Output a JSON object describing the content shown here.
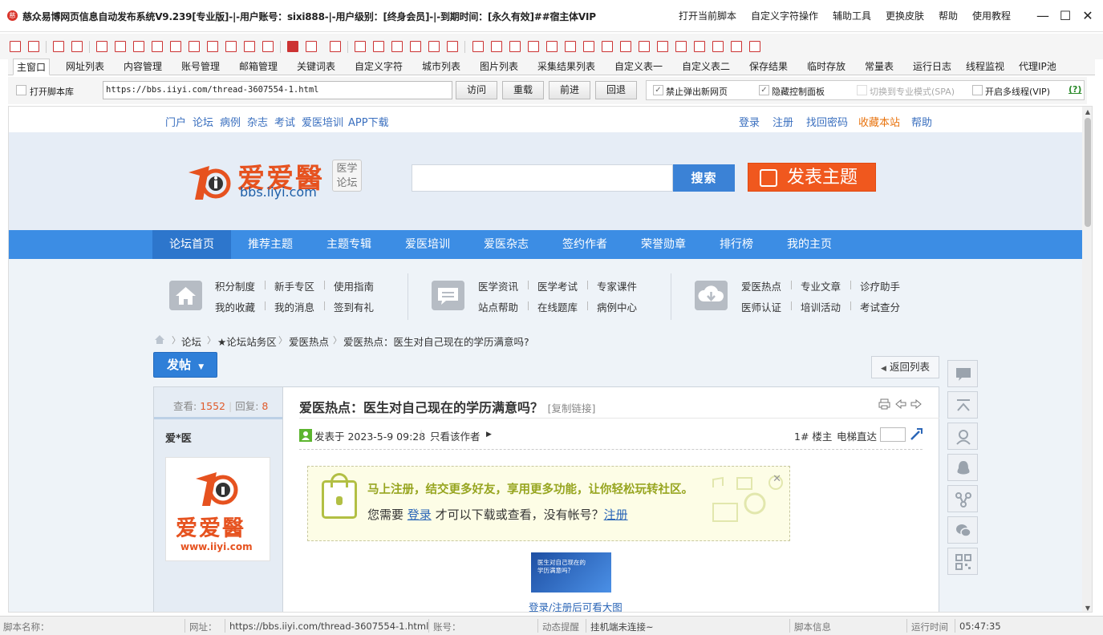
{
  "window": {
    "title": "慈众易博网页信息自动发布系统V9.239[专业版]-|-用户账号：sixi888-|-用户级别：[终身会员]-|-到期时间：[永久有效]##宿主体VIP",
    "menu": [
      "打开当前脚本",
      "自定义字符操作",
      "辅助工具",
      "更换皮肤",
      "帮助",
      "使用教程"
    ],
    "controls": {
      "minimize": "—",
      "maximize": "☐",
      "close": "✕"
    }
  },
  "tabs": [
    "主窗口",
    "网址列表",
    "内容管理",
    "账号管理",
    "邮箱管理",
    "关键词表",
    "自定义字符",
    "城市列表",
    "图片列表",
    "采集结果列表",
    "自定义表一",
    "自定义表二",
    "保存结果",
    "临时存放",
    "常量表",
    "运行日志",
    "线程监视",
    "代理IP池"
  ],
  "addressbar": {
    "open_script_lib": "打开脚本库",
    "url": "https://bbs.iiyi.com/thread-3607554-1.html",
    "buttons": [
      "访问",
      "重载",
      "前进",
      "回退"
    ],
    "options": [
      {
        "label": "禁止弹出新网页",
        "checked": true,
        "disabled": false
      },
      {
        "label": "隐藏控制面板",
        "checked": true,
        "disabled": false
      },
      {
        "label": "切换到专业模式(SPA)",
        "checked": false,
        "disabled": true
      },
      {
        "label": "开启多线程(VIP)",
        "checked": false,
        "disabled": false
      }
    ],
    "help": "(?)"
  },
  "site": {
    "toplinks_left": [
      "门户",
      "论坛",
      "病例",
      "杂志",
      "考试",
      "爱医培训",
      "APP下载"
    ],
    "toplinks_right": [
      "登录",
      "注册",
      "找回密码",
      "收藏本站",
      "帮助"
    ],
    "logo_text": "爱爱醫",
    "logo_domain": "bbs.iiyi.com",
    "logo_badge_1": "医学",
    "logo_badge_2": "论坛",
    "search_button": "搜索",
    "post_button": "发表主题",
    "nav": [
      "论坛首页",
      "推荐主题",
      "主题专辑",
      "爱医培训",
      "爱医杂志",
      "签约作者",
      "荣誉勋章",
      "排行榜",
      "我的主页"
    ],
    "quick_groups": [
      {
        "icon": "home-icon",
        "row1": [
          "积分制度",
          "新手专区",
          "使用指南"
        ],
        "row2": [
          "我的收藏",
          "我的消息",
          "签到有礼"
        ]
      },
      {
        "icon": "message-icon",
        "row1": [
          "医学资讯",
          "医学考试",
          "专家课件"
        ],
        "row2": [
          "站点帮助",
          "在线题库",
          "病例中心"
        ]
      },
      {
        "icon": "download-cloud-icon",
        "row1": [
          "爱医热点",
          "专业文章",
          "诊疗助手"
        ],
        "row2": [
          "医师认证",
          "培训活动",
          "考试查分"
        ]
      }
    ],
    "breadcrumb": [
      "论坛",
      "★论坛站务区",
      "爱医热点",
      "爱医热点：医生对自己现在的学历满意吗?"
    ],
    "fatie_button": "发帖",
    "back_button": "返回列表",
    "post": {
      "views_label": "查看:",
      "views": "1552",
      "replies_label": "回复:",
      "replies": "8",
      "title": "爱医热点：医生对自己现在的学历满意吗？",
      "copy_link": "[复制链接]",
      "author": "爱*医",
      "posted_at": "发表于 2023-5-9 09:28",
      "only_author": "只看该作者",
      "floor": "1# 楼主",
      "elevator": "电梯直达",
      "notice_line1": "马上注册，结交更多好友，享用更多功能，让你轻松玩转社区。",
      "notice_line2_pre": "您需要",
      "notice_login": "登录",
      "notice_line2_mid": "才可以下载或查看，没有帐号？",
      "notice_register": "注册",
      "notice_close": "✕",
      "thumb_caption_1": "医生对自己现在的",
      "thumb_caption_2": "学历满意吗？",
      "thumb_link": "登录/注册后可看大图",
      "avatar_logo_text": "爱爱醫",
      "avatar_domain": "www.iiyi.com"
    }
  },
  "statusbar": {
    "script_name_label": "脚本名称：",
    "url_label": "网址：",
    "url_value": "https://bbs.iiyi.com/thread-3607554-1.html",
    "account_label": "账号：",
    "dynamic_label": "动态提醒",
    "dynamic_value": "挂机端未连接~",
    "script_info_label": "脚本信息",
    "runtime_label": "运行时间",
    "runtime_value": "05:47:35"
  },
  "colors": {
    "accent_blue": "#3c8de4",
    "brand_orange": "#f0581e",
    "notice_green": "#97a520"
  }
}
